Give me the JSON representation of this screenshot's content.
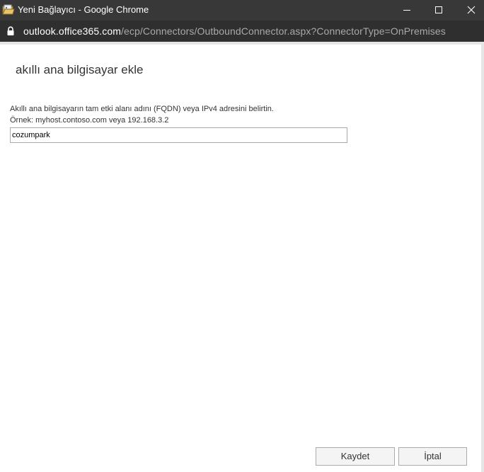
{
  "window": {
    "title": "Yeni Bağlayıcı - Google Chrome",
    "icon": "folder-document-icon",
    "controls": [
      "minimize-icon",
      "maximize-icon",
      "close-icon"
    ]
  },
  "address_bar": {
    "host": "outlook.office365.com",
    "path": "/ecp/Connectors/OutboundConnector.aspx?ConnectorType=OnPremises"
  },
  "dialog": {
    "heading": "akıllı ana bilgisayar ekle",
    "instruction": "Akıllı ana bilgisayarın tam etki alanı adını (FQDN) veya IPv4 adresini belirtin.",
    "example": "Örnek: myhost.contoso.com veya 192.168.3.2",
    "host_value": "cozumpark",
    "save_label": "Kaydet",
    "cancel_label": "İptal"
  },
  "colors": {
    "titlebar": "#383838",
    "addressbar": "#2f2f2f",
    "url_host": "#ffffff",
    "url_path": "#a9a9a9",
    "button_bg": "#f4f4f4",
    "border": "#ababab"
  }
}
